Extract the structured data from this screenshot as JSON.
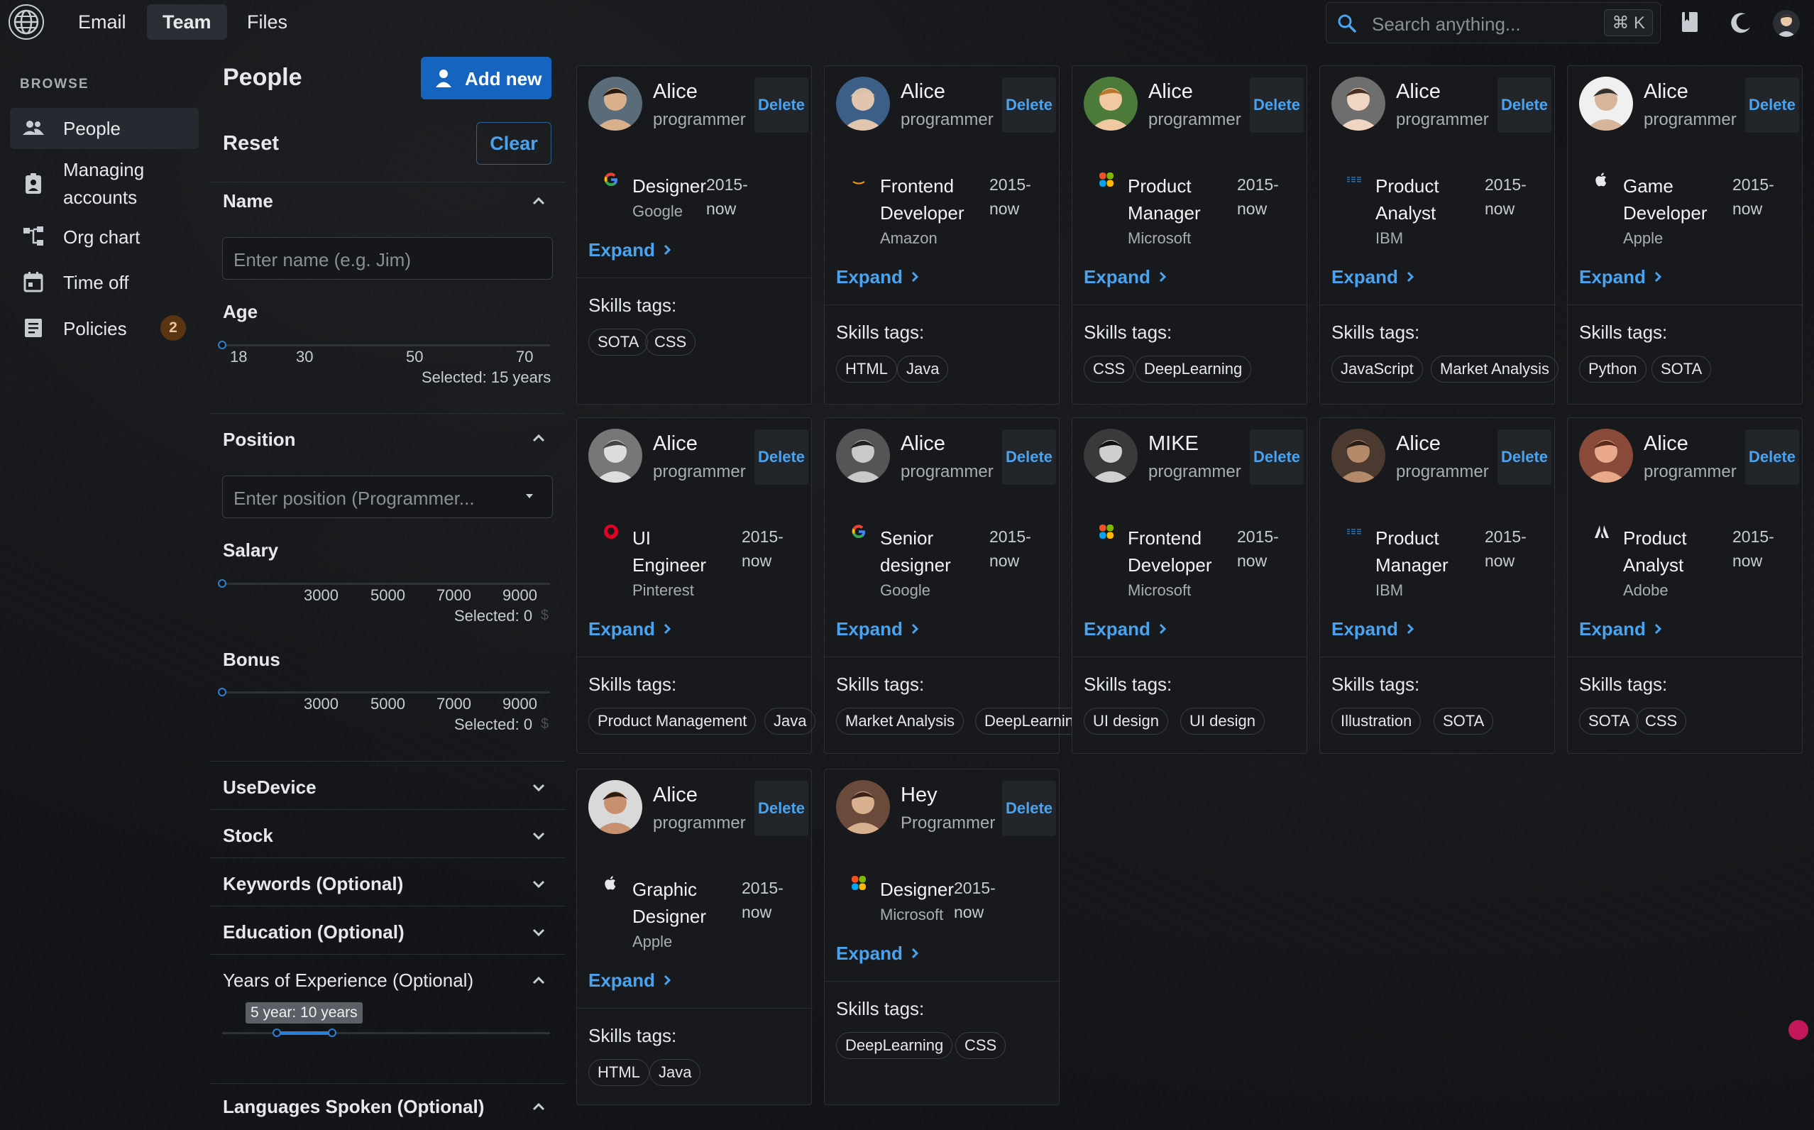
{
  "topnav": {
    "tabs": [
      "Email",
      "Team",
      "Files"
    ],
    "active_tab": "Team",
    "search_placeholder": "Search anything...",
    "search_shortcut": "⌘ K",
    "icons": [
      "globe-icon",
      "bookmark-icon",
      "moon-icon",
      "user-avatar"
    ]
  },
  "sidebar": {
    "section_label": "BROWSE",
    "items": [
      {
        "label": "People",
        "icon": "people-icon",
        "active": true
      },
      {
        "label": "Managing accounts",
        "icon": "badge-icon",
        "active": false
      },
      {
        "label": "Org chart",
        "icon": "org-chart-icon",
        "active": false
      },
      {
        "label": "Time off",
        "icon": "calendar-icon",
        "active": false
      },
      {
        "label": "Policies",
        "icon": "document-icon",
        "active": false,
        "badge": "2"
      }
    ]
  },
  "filters": {
    "title": "People",
    "add_button": "Add new",
    "reset_label": "Reset",
    "clear_button": "Clear",
    "name": {
      "label": "Name",
      "placeholder": "Enter name (e.g. Jim)"
    },
    "age": {
      "label": "Age",
      "ticks": [
        "18",
        "30",
        "50",
        "70"
      ],
      "selected": "Selected: 15 years"
    },
    "position": {
      "label": "Position",
      "placeholder": "Enter position (Programmer..."
    },
    "salary": {
      "label": "Salary",
      "ticks": [
        "3000",
        "5000",
        "7000",
        "9000"
      ],
      "selected": "Selected: 0",
      "unit": "$"
    },
    "bonus": {
      "label": "Bonus",
      "ticks": [
        "3000",
        "5000",
        "7000",
        "9000"
      ],
      "selected": "Selected: 0",
      "unit": "$"
    },
    "collapsed_sections": [
      "UseDevice",
      "Stock",
      "Keywords (Optional)",
      "Education (Optional)"
    ],
    "experience": {
      "label": "Years of Experience (Optional)",
      "range_tooltip": "5 year: 10 years"
    },
    "languages": {
      "label": "Languages Spoken (Optional)"
    }
  },
  "cards": [
    {
      "name": "Alice",
      "role": "programmer",
      "title": [
        "Designer"
      ],
      "company": "Google",
      "logo": "google-logo",
      "years": [
        "2015-",
        "now"
      ],
      "tags": [
        "SOTA",
        "CSS"
      ]
    },
    {
      "name": "Alice",
      "role": "programmer",
      "title": [
        "Frontend",
        "Developer"
      ],
      "company": "Amazon",
      "logo": "amazon-logo",
      "years": [
        "2015-",
        "now"
      ],
      "tags": [
        "HTML",
        "Java"
      ]
    },
    {
      "name": "Alice",
      "role": "programmer",
      "title": [
        "Product",
        "Manager"
      ],
      "company": "Microsoft",
      "logo": "microsoft-logo",
      "years": [
        "2015-",
        "now"
      ],
      "tags": [
        "CSS",
        "DeepLearning"
      ]
    },
    {
      "name": "Alice",
      "role": "programmer",
      "title": [
        "Product",
        "Analyst"
      ],
      "company": "IBM",
      "logo": "ibm-logo",
      "years": [
        "2015-",
        "now"
      ],
      "tags": [
        "JavaScript",
        "Market Analysis"
      ]
    },
    {
      "name": "Alice",
      "role": "programmer",
      "title": [
        "Game",
        "Developer"
      ],
      "company": "Apple",
      "logo": "apple-logo",
      "years": [
        "2015-",
        "now"
      ],
      "tags": [
        "Python",
        "SOTA"
      ]
    },
    {
      "name": "Alice",
      "role": "programmer",
      "title": [
        "UI",
        "Engineer"
      ],
      "company": "Pinterest",
      "logo": "pinterest-logo",
      "years": [
        "2015-",
        "now"
      ],
      "tags": [
        "Product Management",
        "Java"
      ]
    },
    {
      "name": "Alice",
      "role": "programmer",
      "title": [
        "Senior",
        "designer"
      ],
      "company": "Google",
      "logo": "google-logo",
      "years": [
        "2015-",
        "now"
      ],
      "tags": [
        "Market Analysis",
        "DeepLearnin"
      ]
    },
    {
      "name": "MIKE",
      "role": "programmer",
      "title": [
        "Frontend",
        "Developer"
      ],
      "company": "Microsoft",
      "logo": "microsoft-logo",
      "years": [
        "2015-",
        "now"
      ],
      "tags": [
        "UI design",
        "UI design"
      ]
    },
    {
      "name": "Alice",
      "role": "programmer",
      "title": [
        "Product",
        "Manager"
      ],
      "company": "IBM",
      "logo": "ibm-logo",
      "years": [
        "2015-",
        "now"
      ],
      "tags": [
        "Illustration",
        "SOTA"
      ]
    },
    {
      "name": "Alice",
      "role": "programmer",
      "title": [
        "Product",
        "Analyst"
      ],
      "company": "Adobe",
      "logo": "adobe-logo",
      "years": [
        "2015-",
        "now"
      ],
      "tags": [
        "SOTA",
        "CSS"
      ]
    },
    {
      "name": "Alice",
      "role": "programmer",
      "title": [
        "Graphic",
        "Designer"
      ],
      "company": "Apple",
      "logo": "apple-logo",
      "years": [
        "2015-",
        "now"
      ],
      "tags": [
        "HTML",
        "Java"
      ]
    },
    {
      "name": "Hey",
      "role": "Programmer",
      "title": [
        "Designer"
      ],
      "company": "Microsoft",
      "logo": "microsoft-logo",
      "years": [
        "2015-",
        "now"
      ],
      "tags": [
        "DeepLearning",
        "CSS"
      ]
    }
  ],
  "card_labels": {
    "delete": "Delete",
    "expand": "Expand",
    "skills": "Skills tags:"
  }
}
